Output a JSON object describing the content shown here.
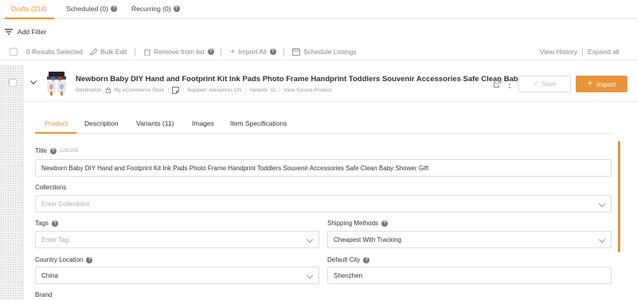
{
  "top_tabs": [
    {
      "label": "Drafts (214)"
    },
    {
      "label": "Scheduled (0)"
    },
    {
      "label": "Recurring (0)"
    }
  ],
  "filter": {
    "label": "Add Filter"
  },
  "actions": {
    "results_selected": "0 Results Selected",
    "bulk_edit": "Bulk Edit",
    "remove_from_list": "Remove from list",
    "import_all": "Import All",
    "schedule_listings": "Schedule Listings",
    "view_history": "View History",
    "expand_all": "Expand all"
  },
  "product": {
    "title": "Newborn Baby DIY Hand and Footprint Kit Ink Pads Photo Frame Handprint Toddlers Souvenir Accessories Safe Clean Bab...",
    "destination_label": "Destination:",
    "destination_value": "My eCommerce Store",
    "supplier": "Supplier: Aliexpress CN",
    "variants": "Variants: 11",
    "view_source": "View Source Product",
    "save_label": "Save",
    "import_label": "Import"
  },
  "product_tabs": [
    {
      "label": "Product"
    },
    {
      "label": "Description"
    },
    {
      "label": "Variants (11)"
    },
    {
      "label": "Images"
    },
    {
      "label": "Item Specifications"
    }
  ],
  "form": {
    "title_label": "Title",
    "title_count": "128/255",
    "title_value": "Newborn Baby DIY Hand and Footprint Kit Ink Pads Photo Frame Handprint Toddlers Souvenir Accessories Safe Clean Baby Shower Gift",
    "collections_label": "Collections",
    "collections_placeholder": "Enter Collections",
    "tags_label": "Tags",
    "tags_placeholder": "Enter Tag",
    "shipping_label": "Shipping Methods",
    "shipping_value": "Cheapest With Tracking",
    "country_label": "Country Location",
    "country_value": "China",
    "city_label": "Default City",
    "city_value": "Shenzhen",
    "brand_label": "Brand"
  },
  "colors": {
    "accent": "#e8943a"
  }
}
